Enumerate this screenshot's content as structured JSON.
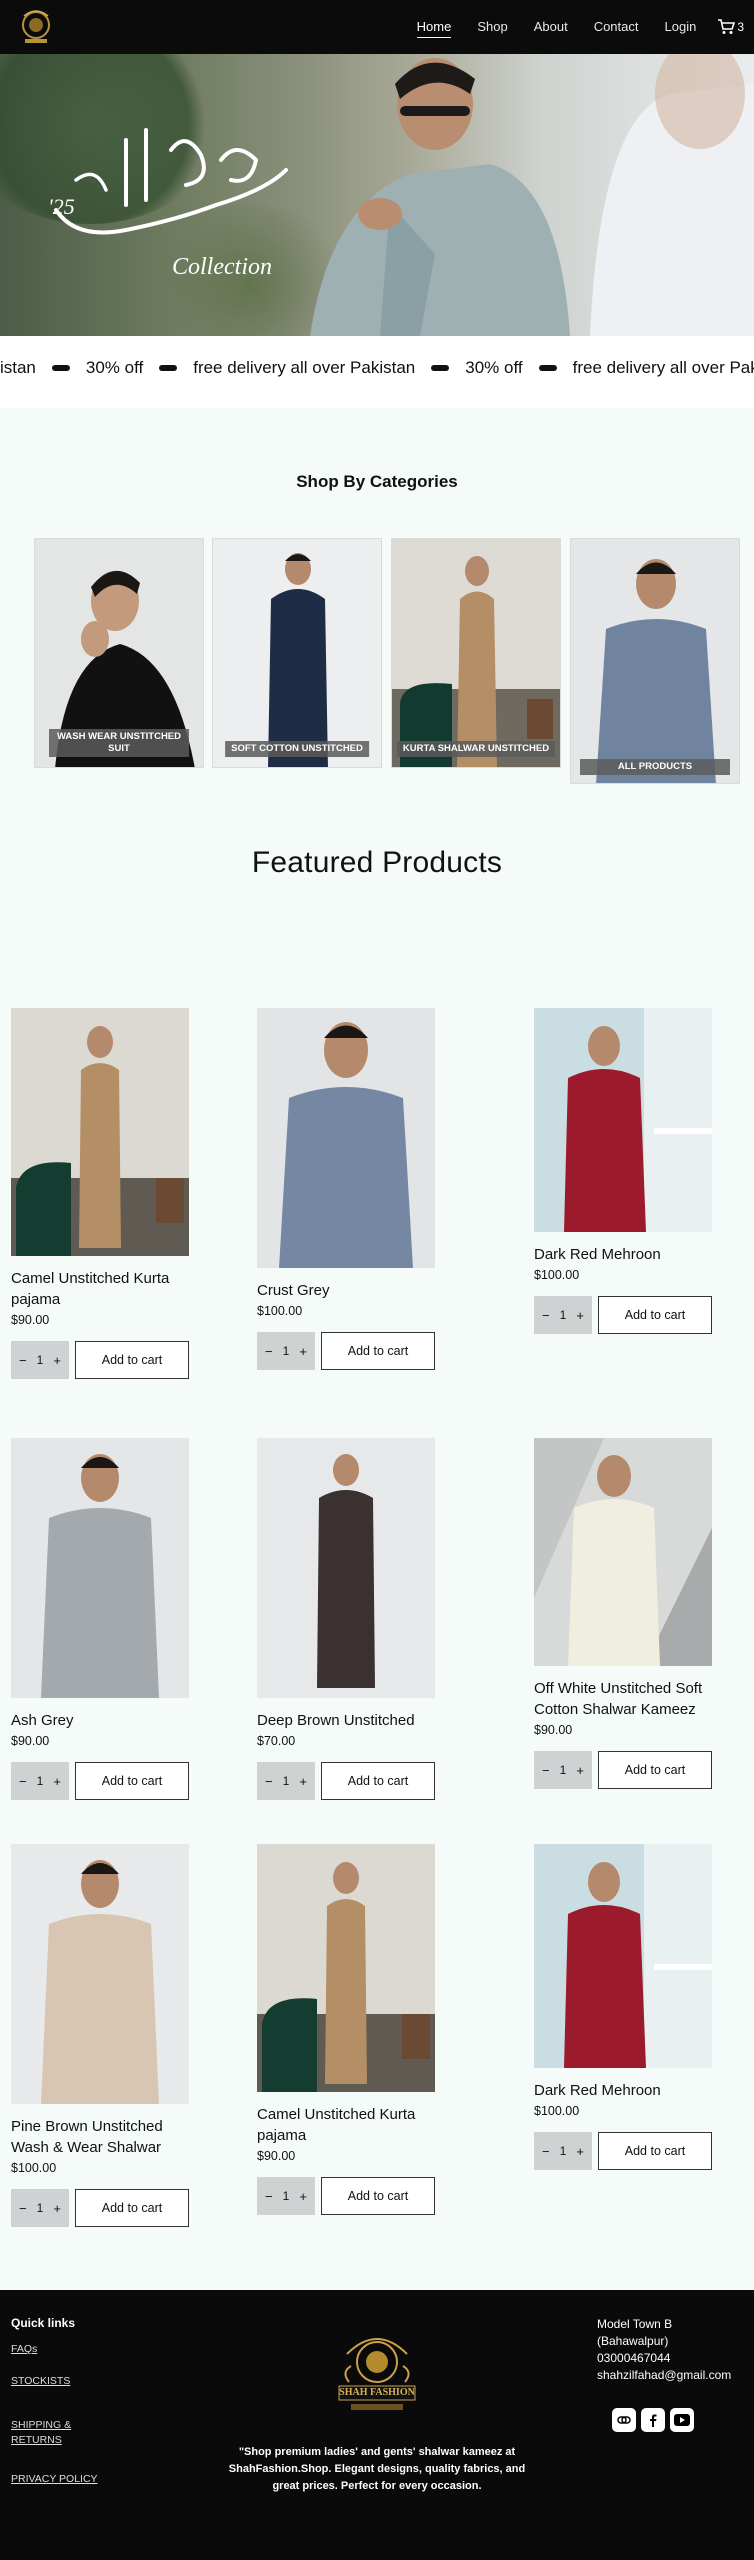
{
  "nav": {
    "items": [
      "Home",
      "Shop",
      "About",
      "Contact",
      "Login"
    ],
    "cart_count": "3"
  },
  "hero": {
    "year": "'25",
    "collection": "Collection"
  },
  "marquee": {
    "items": [
      "akistan",
      "30% off",
      "free delivery all over Pakistan",
      "30% off",
      "free delivery all over Pakistan"
    ]
  },
  "categories": {
    "title": "Shop By Categories",
    "items": [
      {
        "label": "WASH WEAR UNSTITCHED SUIT"
      },
      {
        "label": "SOFT COTTON UNSTITCHED"
      },
      {
        "label": "KURTA SHALWAR UNSTITCHED"
      },
      {
        "label": "ALL PRODUCTS"
      }
    ]
  },
  "featured": {
    "title": "Featured Products",
    "add_to_cart": "Add to cart",
    "qty": "1",
    "products": [
      {
        "name": "Camel Unstitched Kurta pajama",
        "price": "$90.00"
      },
      {
        "name": "Crust Grey",
        "price": "$100.00"
      },
      {
        "name": "Dark Red Mehroon",
        "price": "$100.00"
      },
      {
        "name": "Ash Grey",
        "price": "$90.00"
      },
      {
        "name": "Deep Brown Unstitched",
        "price": "$70.00"
      },
      {
        "name": "Off White Unstitched Soft Cotton Shalwar Kameez",
        "price": "$90.00"
      },
      {
        "name": "Pine Brown Unstitched Wash & Wear Shalwar",
        "price": "$100.00"
      },
      {
        "name": "Camel Unstitched Kurta pajama",
        "price": "$90.00"
      },
      {
        "name": "Dark Red Mehroon",
        "price": "$100.00"
      }
    ]
  },
  "footer": {
    "quick_links_title": "Quick links",
    "links": [
      "FAQs",
      "STOCKISTS",
      "SHIPPING & RETURNS",
      "PRIVACY POLICY"
    ],
    "logo_text": "SHAH FASHION",
    "tagline": "\"Shop premium ladies' and gents' shalwar kameez at ShahFashion.Shop. Elegant designs, quality fabrics, and great prices. Perfect for every occasion.",
    "address": "Model Town B (Bahawalpur)",
    "phone": "03000467044",
    "email": "shahzilfahad@gmail.com"
  },
  "colors": {
    "header_bg": "#0b0b0b",
    "page_bg": "#f4fbf9",
    "button_border": "#333333",
    "qty_bg": "#cfd2d2"
  }
}
